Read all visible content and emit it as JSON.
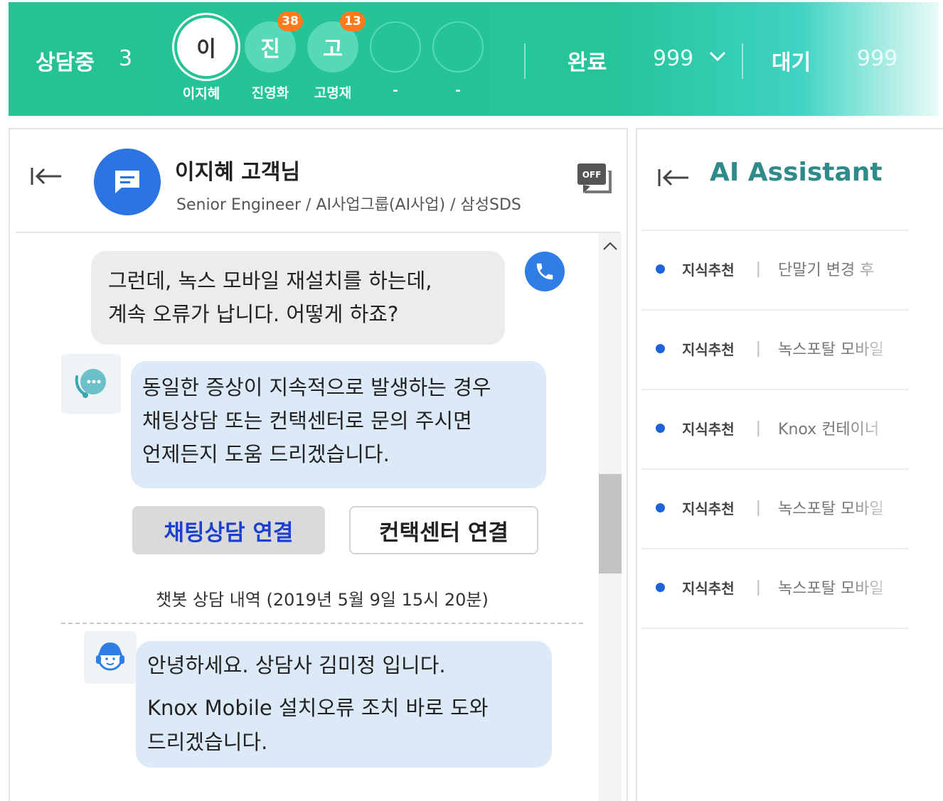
{
  "topbar": {
    "in_progress_label": "상담중",
    "in_progress_count": "3",
    "agents": [
      {
        "initial": "이",
        "name": "이지혜",
        "badge": ""
      },
      {
        "initial": "진",
        "name": "진영화",
        "badge": "38"
      },
      {
        "initial": "고",
        "name": "고명재",
        "badge": "13"
      },
      {
        "initial": "",
        "name": "-",
        "badge": ""
      },
      {
        "initial": "",
        "name": "-",
        "badge": ""
      }
    ],
    "done_label": "완료",
    "done_count": "999",
    "wait_label": "대기",
    "wait_count": "999"
  },
  "chat": {
    "customer_name": "이지혜 고객님",
    "customer_sub": "Senior Engineer / AI사업그룹(AI사업) / 삼성SDS",
    "off_label": "OFF",
    "messages": {
      "customer_line1": "그런데, 녹스 모바일 재설치를 하는데,",
      "customer_line2": "계속 오류가 납니다. 어떻게 하죠?",
      "bot_line1": "동일한 증상이 지속적으로 발생하는 경우",
      "bot_line2": "채팅상담 또는 컨택센터로 문의 주시면",
      "bot_line3": "언제든지 도움 드리겠습니다.",
      "agent_line1": "안녕하세요. 상담사 김미정 입니다.",
      "agent_line2": "Knox Mobile  설치오류 조치 바로 도와",
      "agent_line3": "드리겠습니다."
    },
    "buttons": {
      "chat_connect": "채팅상담 연결",
      "center_connect": "컨택센터 연결"
    },
    "history_label": "챗봇 상담 내역 (2019년 5월 9일 15시 20분)"
  },
  "ai_assistant": {
    "title": "AI Assistant",
    "items": [
      {
        "category": "지식추천",
        "text": "단말기 변경 후 "
      },
      {
        "category": "지식추천",
        "text": "녹스포탈 모바일"
      },
      {
        "category": "지식추천",
        "text": "Knox 컨테이너"
      },
      {
        "category": "지식추천",
        "text": "녹스포탈 모바일"
      },
      {
        "category": "지식추천",
        "text": "녹스포탈 모바일"
      }
    ]
  },
  "colors": {
    "topbar_green": "#25c293",
    "badge_orange": "#ff7a1a",
    "avatar_blue": "#2b74e2",
    "bubble_blue": "#dce9f7",
    "bubble_grey": "#ececec",
    "ai_title": "#2f8a8a"
  }
}
